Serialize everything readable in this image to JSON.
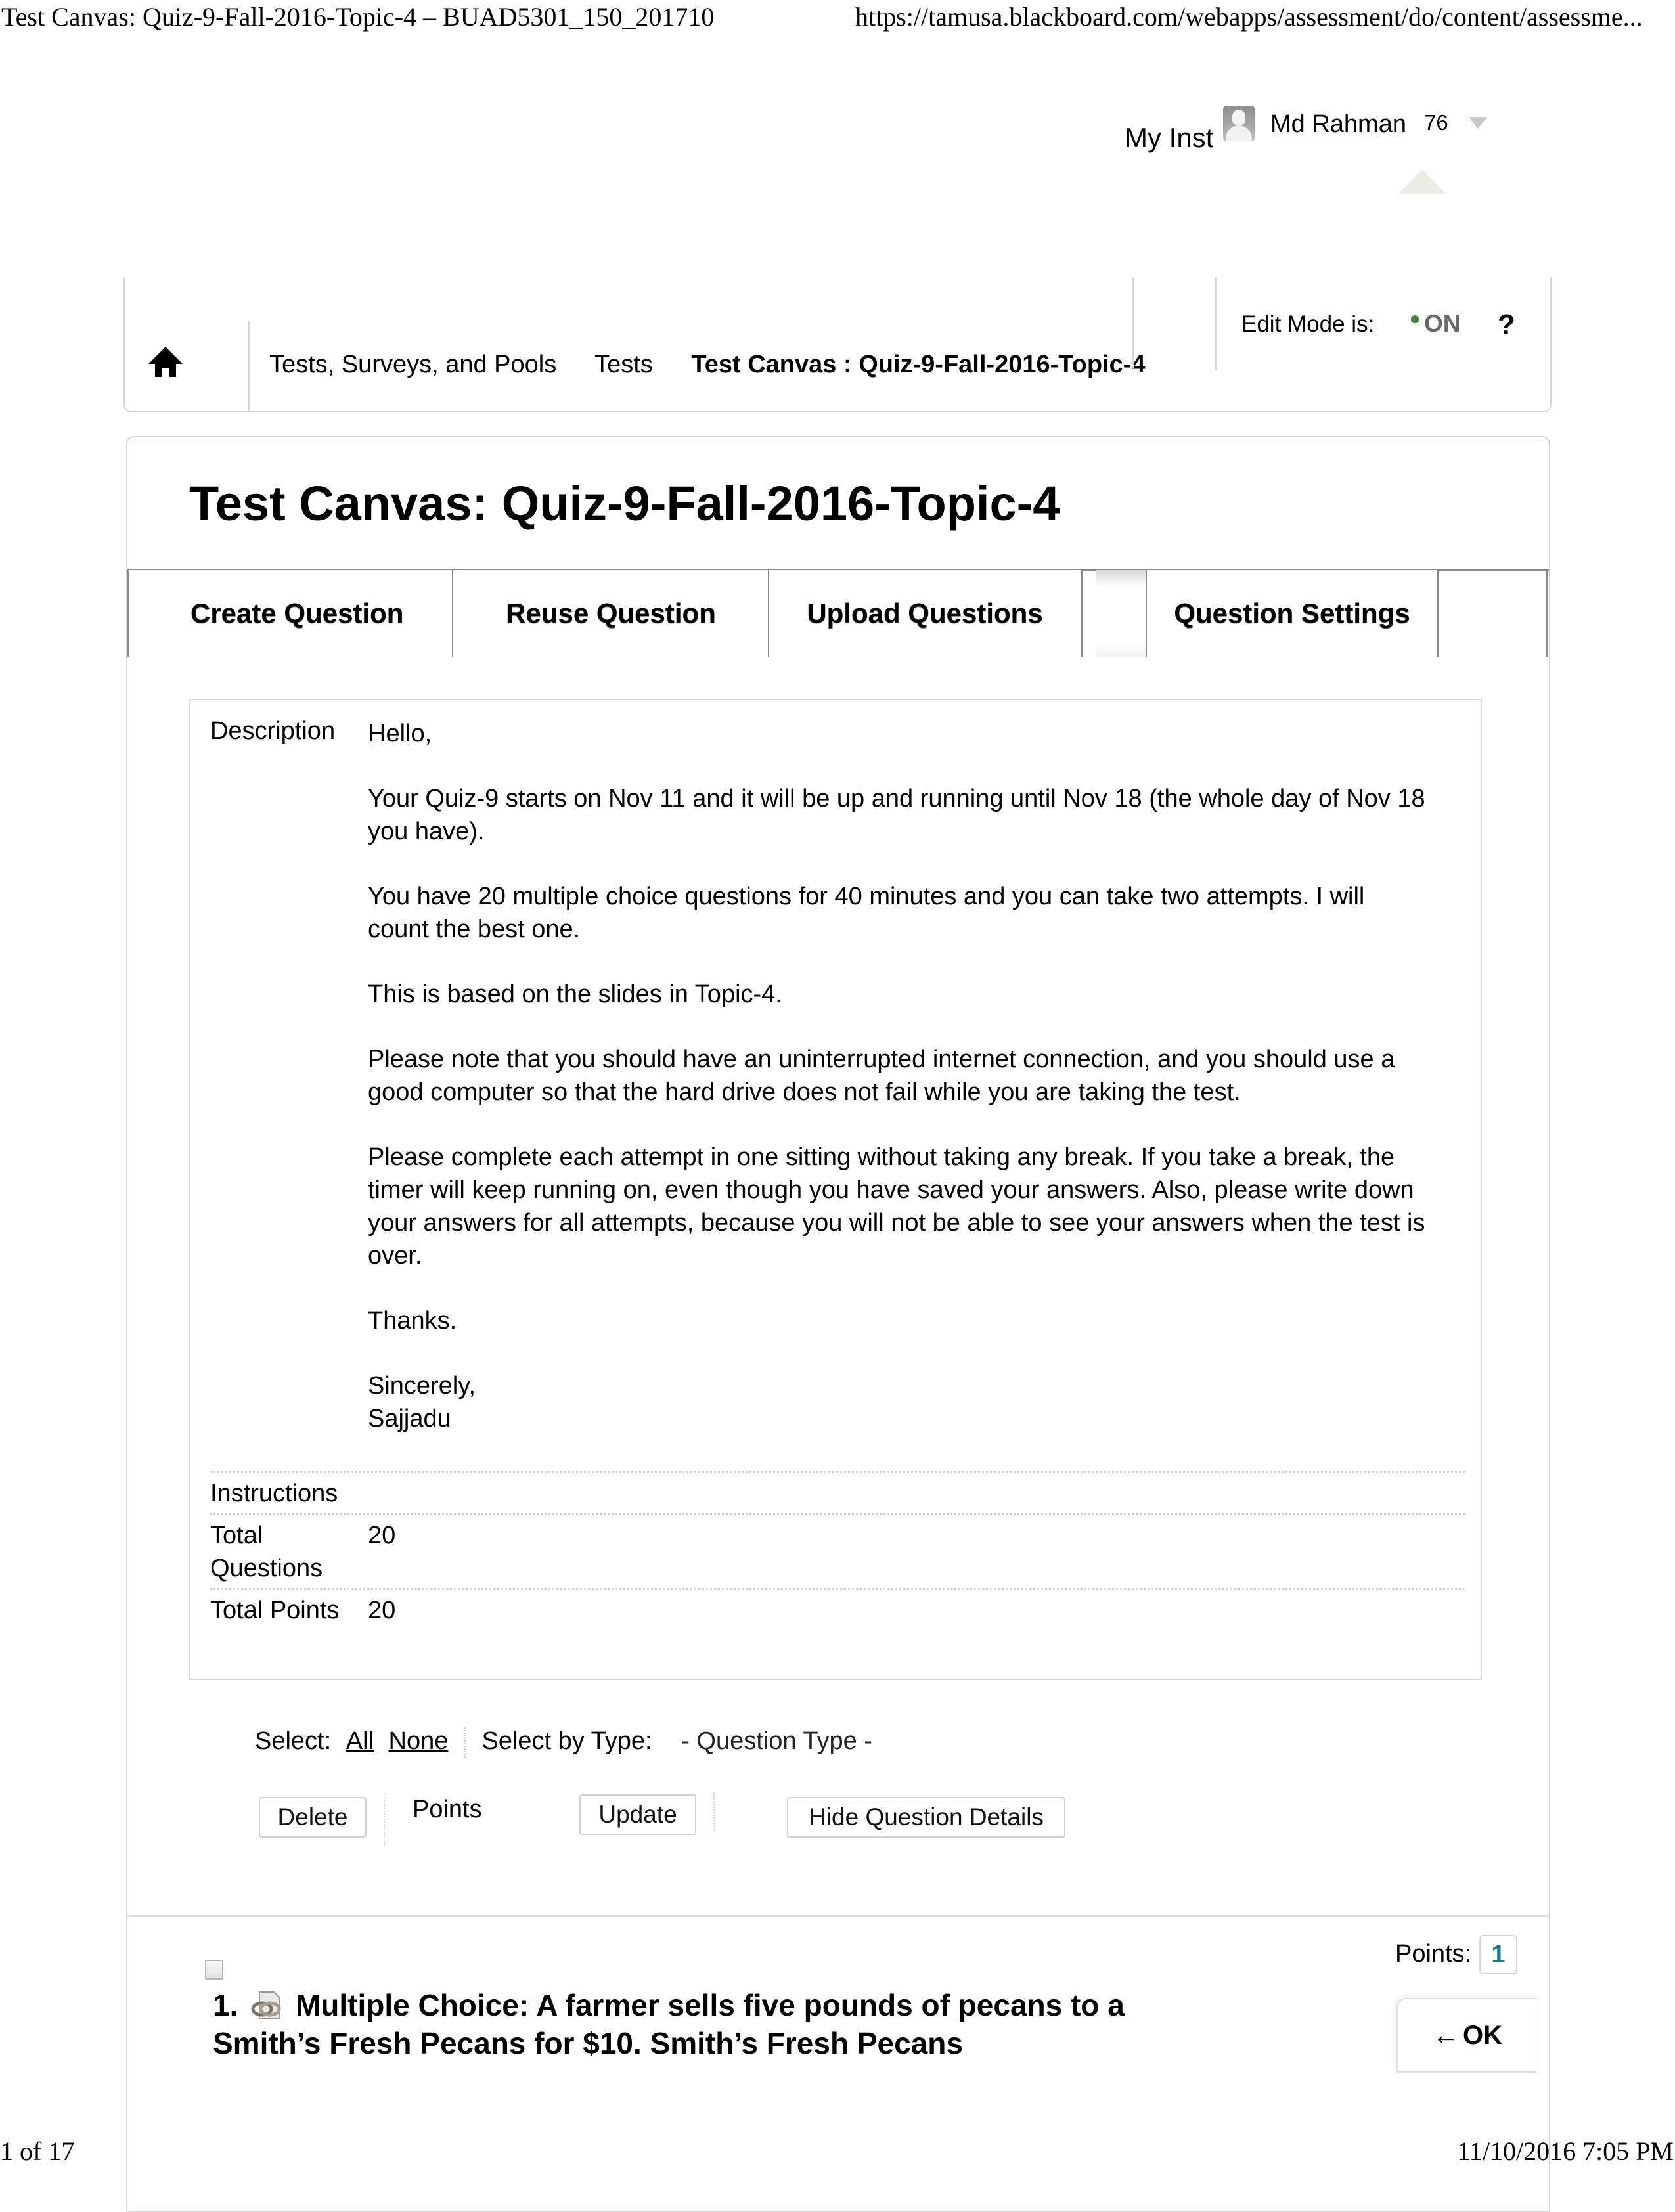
{
  "print_header": {
    "title": "Test Canvas: Quiz-9-Fall-2016-Topic-4 – BUAD5301_150_201710",
    "url": "https://tamusa.blackboard.com/webapps/assessment/do/content/assessme..."
  },
  "print_footer": {
    "page": "1 of 17",
    "datetime": "11/10/2016 7:05 PM"
  },
  "topbar": {
    "my_inst_label": "My Inst",
    "user_name": "Md Rahman",
    "notification_count": "76"
  },
  "breadcrumb": {
    "items": [
      "Tests, Surveys, and Pools",
      "Tests"
    ],
    "current": "Test Canvas : Quiz-9-Fall-2016-Topic-4"
  },
  "edit_mode": {
    "label": "Edit Mode is:",
    "state": "ON",
    "help": "?"
  },
  "page": {
    "title": "Test Canvas: Quiz-9-Fall-2016-Topic-4"
  },
  "tabs": [
    {
      "label": "Create Question"
    },
    {
      "label": "Reuse Question"
    },
    {
      "label": "Upload Questions"
    },
    {
      "label": "Question Settings"
    }
  ],
  "details": {
    "description_label": "Description",
    "description_paragraphs": [
      "Hello,",
      "Your Quiz-9 starts on Nov 11 and it will be up and running until Nov 18 (the whole day of Nov 18 you have).",
      "You have 20 multiple choice questions for 40 minutes and you can take two attempts. I will count the best one.",
      "This is based on the slides in Topic-4.",
      "Please note that you should have an uninterrupted internet connection, and you should use a good computer so that the hard drive does not fail while you are taking the test.",
      "Please complete each attempt in one sitting without taking any break. If you take a break, the timer will keep running on, even though you have saved your answers. Also, please write down your answers for all attempts, because you will not be able to see your answers when the test is over.",
      "Thanks."
    ],
    "closing": "Sincerely,",
    "signature": "Sajjadu",
    "instructions_label": "Instructions",
    "instructions_value": "",
    "total_questions_label": "Total Questions",
    "total_questions_value": "20",
    "total_points_label": "Total Points",
    "total_points_value": "20"
  },
  "toolbar": {
    "select_label": "Select:",
    "select_all": "All",
    "select_none": "None",
    "select_by_type_label": "Select by Type:",
    "question_type_selected": "- Question Type -",
    "delete_label": "Delete",
    "points_label": "Points",
    "update_label": "Update",
    "hide_details_label": "Hide Question Details"
  },
  "question": {
    "number": "1.",
    "icon": "linked-question-icon",
    "title": "Multiple Choice: A farmer sells five pounds of pecans to a Smith’s Fresh Pecans for $10. Smith’s Fresh Pecans",
    "points_label": "Points:",
    "points_value": "1",
    "ok_label": "OK",
    "ok_arrow": "←"
  },
  "colors": {
    "points_value": "#177c90",
    "edit_on_dot": "#4b7a4b",
    "border": "#d4d4d4"
  }
}
